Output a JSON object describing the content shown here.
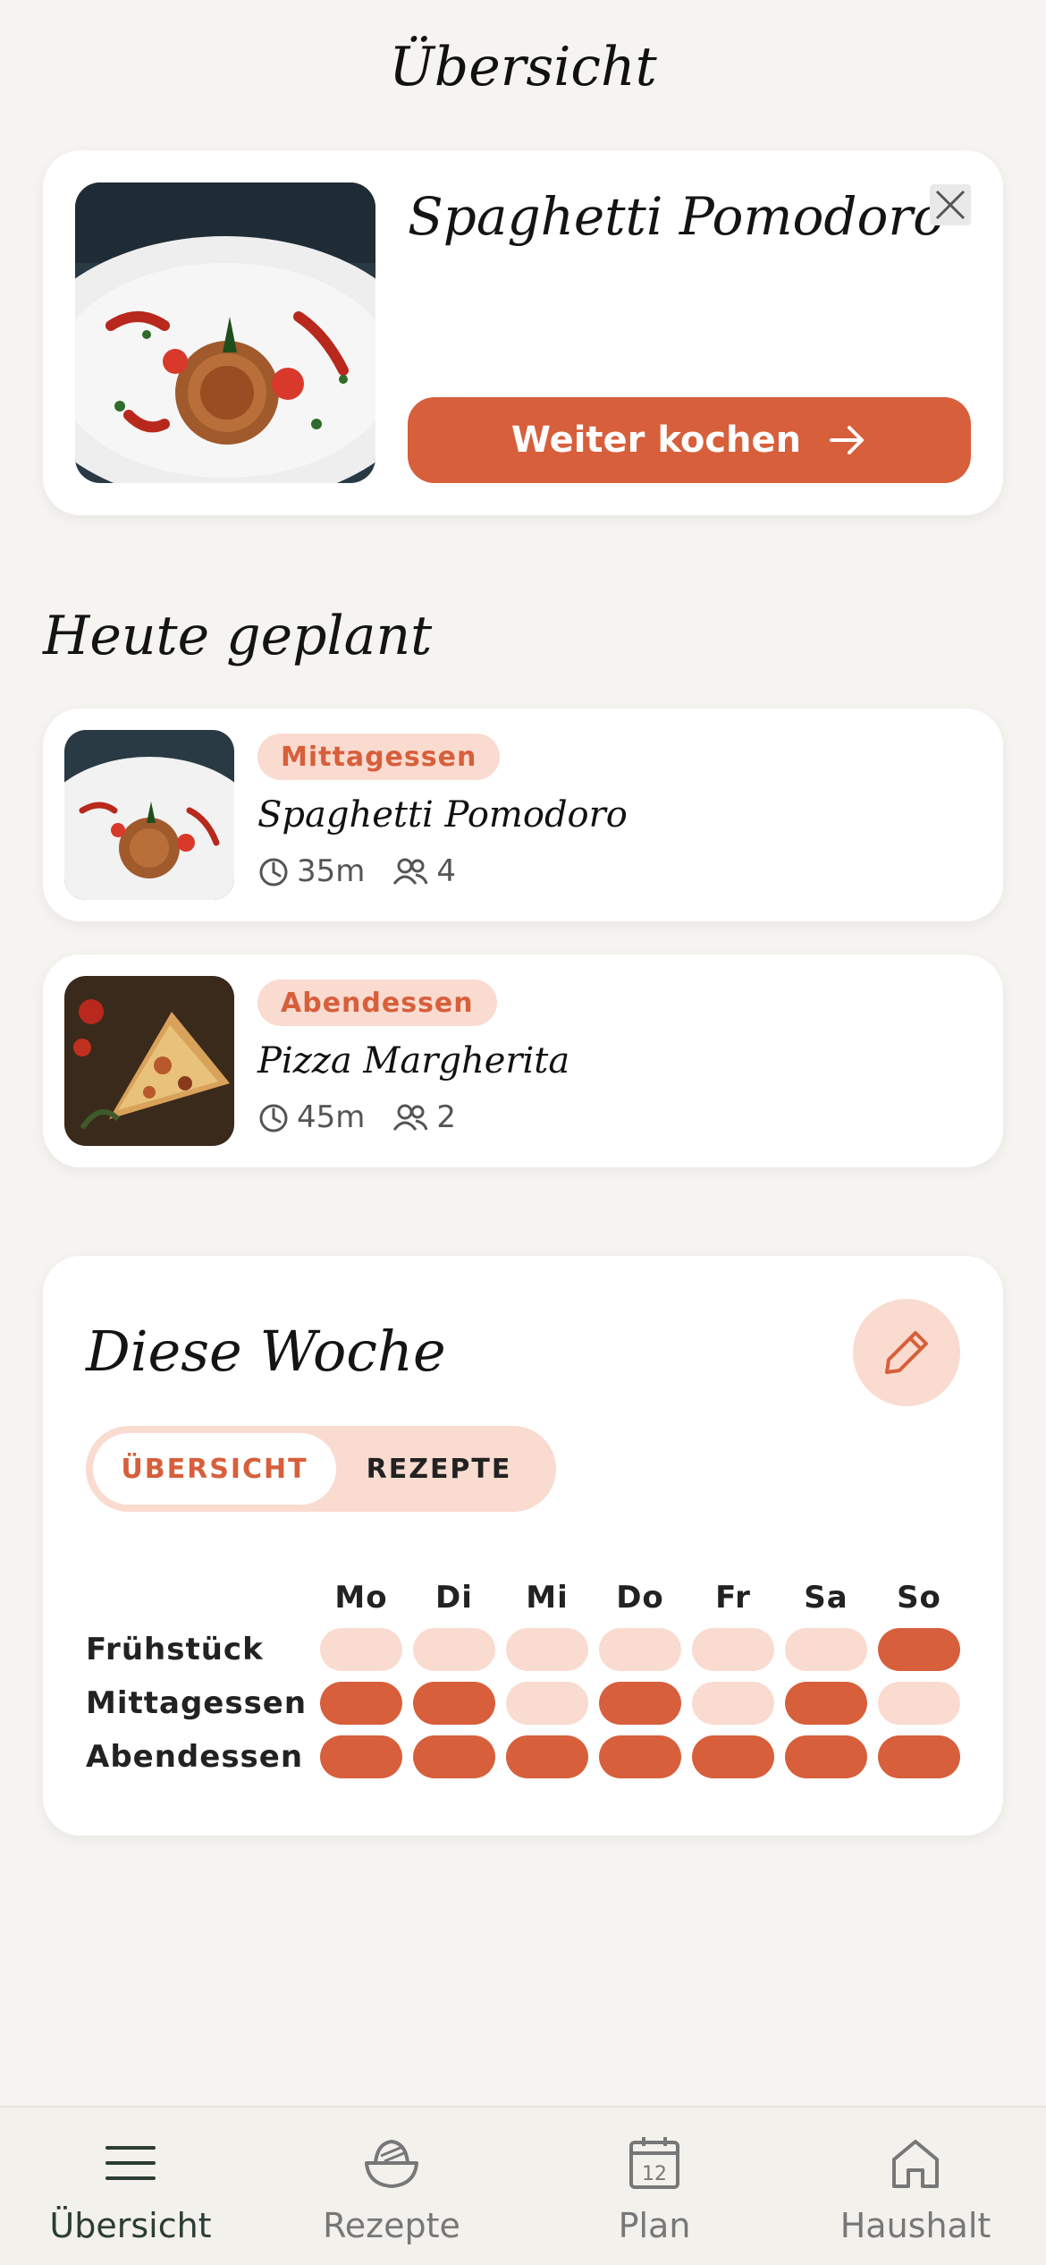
{
  "header": {
    "title": "Übersicht"
  },
  "continue_card": {
    "image": "spaghetti-photo",
    "title": "Spaghetti Pomodoro",
    "button_label": "Weiter kochen",
    "close_icon": "close-icon"
  },
  "today": {
    "title": "Heute geplant",
    "meals": [
      {
        "tag": "Mittagessen",
        "name": "Spaghetti Pomodoro",
        "time": "35m",
        "servings": "4",
        "image": "spaghetti-photo"
      },
      {
        "tag": "Abendessen",
        "name": "Pizza Margherita",
        "time": "45m",
        "servings": "2",
        "image": "pizza-photo"
      }
    ]
  },
  "week": {
    "title": "Diese Woche",
    "edit_icon": "pencil-icon",
    "segments": {
      "active": "ÜBERSICHT",
      "inactive": "REZEPTE"
    },
    "days": [
      "Mo",
      "Di",
      "Mi",
      "Do",
      "Fr",
      "Sa",
      "So"
    ],
    "rows": [
      {
        "label": "Frühstück",
        "planned": [
          false,
          false,
          false,
          false,
          false,
          false,
          true
        ]
      },
      {
        "label": "Mittagessen",
        "planned": [
          true,
          true,
          false,
          true,
          false,
          true,
          false
        ]
      },
      {
        "label": "Abendessen",
        "planned": [
          true,
          true,
          true,
          true,
          true,
          true,
          true
        ]
      }
    ]
  },
  "colors": {
    "accent": "#d75f3b",
    "accent_light": "#fadbd0",
    "background": "#f6f4f0"
  },
  "tabbar": {
    "items": [
      {
        "label": "Übersicht",
        "icon": "menu-icon",
        "active": true
      },
      {
        "label": "Rezepte",
        "icon": "bowl-icon",
        "active": false
      },
      {
        "label": "Plan",
        "icon": "calendar-icon",
        "active": false,
        "icon_text": "12"
      },
      {
        "label": "Haushalt",
        "icon": "home-icon",
        "active": false
      }
    ]
  }
}
